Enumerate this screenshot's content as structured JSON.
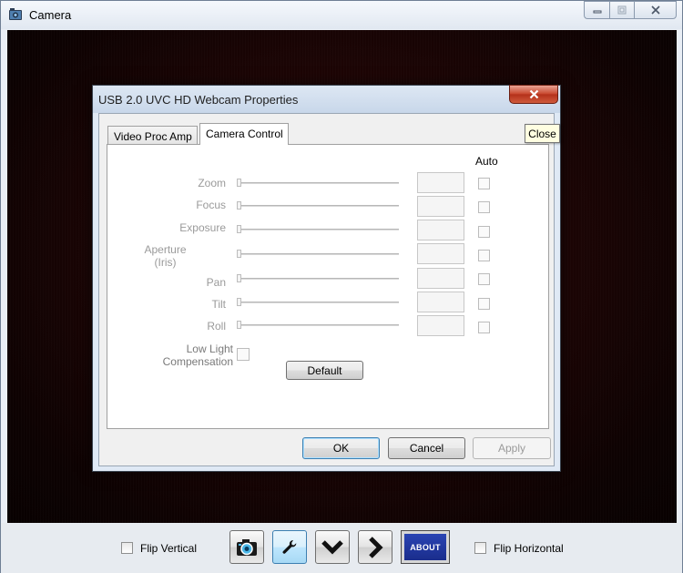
{
  "window": {
    "title": "Camera",
    "icon": "camera-app-icon",
    "controls": {
      "minimize": "▭",
      "maximize": "□",
      "close": "✕"
    }
  },
  "dialog": {
    "title": "USB 2.0 UVC HD Webcam Properties",
    "close_glyph": "✕",
    "close_tooltip": "Close",
    "tabs": [
      {
        "label": "Video Proc Amp",
        "selected": false
      },
      {
        "label": "Camera Control",
        "selected": true
      }
    ],
    "auto_header": "Auto",
    "properties": [
      {
        "label": "Zoom",
        "enabled": false
      },
      {
        "label": "Focus",
        "enabled": false
      },
      {
        "label": "Exposure",
        "enabled": false
      },
      {
        "label": "Aperture\n(Iris)",
        "enabled": false
      },
      {
        "label": "Pan",
        "enabled": false
      },
      {
        "label": "Tilt",
        "enabled": false
      },
      {
        "label": "Roll",
        "enabled": false
      }
    ],
    "low_light_label": "Low Light\nCompensation",
    "default_button": "Default",
    "ok_button": "OK",
    "cancel_button": "Cancel",
    "apply_button": "Apply"
  },
  "toolbar": {
    "flip_vertical": {
      "label": "Flip Vertical",
      "checked": false
    },
    "flip_horizontal": {
      "label": "Flip Horizontal",
      "checked": false
    },
    "buttons": [
      {
        "name": "capture-photo",
        "icon": "camera-icon"
      },
      {
        "name": "settings",
        "icon": "wrench-icon",
        "active": true
      },
      {
        "name": "expand",
        "icon": "chevron-down-icon"
      },
      {
        "name": "next",
        "icon": "chevron-right-icon"
      }
    ],
    "about_label": "ABOUT"
  },
  "colors": {
    "preview_bg": "#1a0404",
    "dialog_close": "#c7442a",
    "about_bg": "#1f35a0",
    "tooltip_bg": "#fffee1"
  }
}
